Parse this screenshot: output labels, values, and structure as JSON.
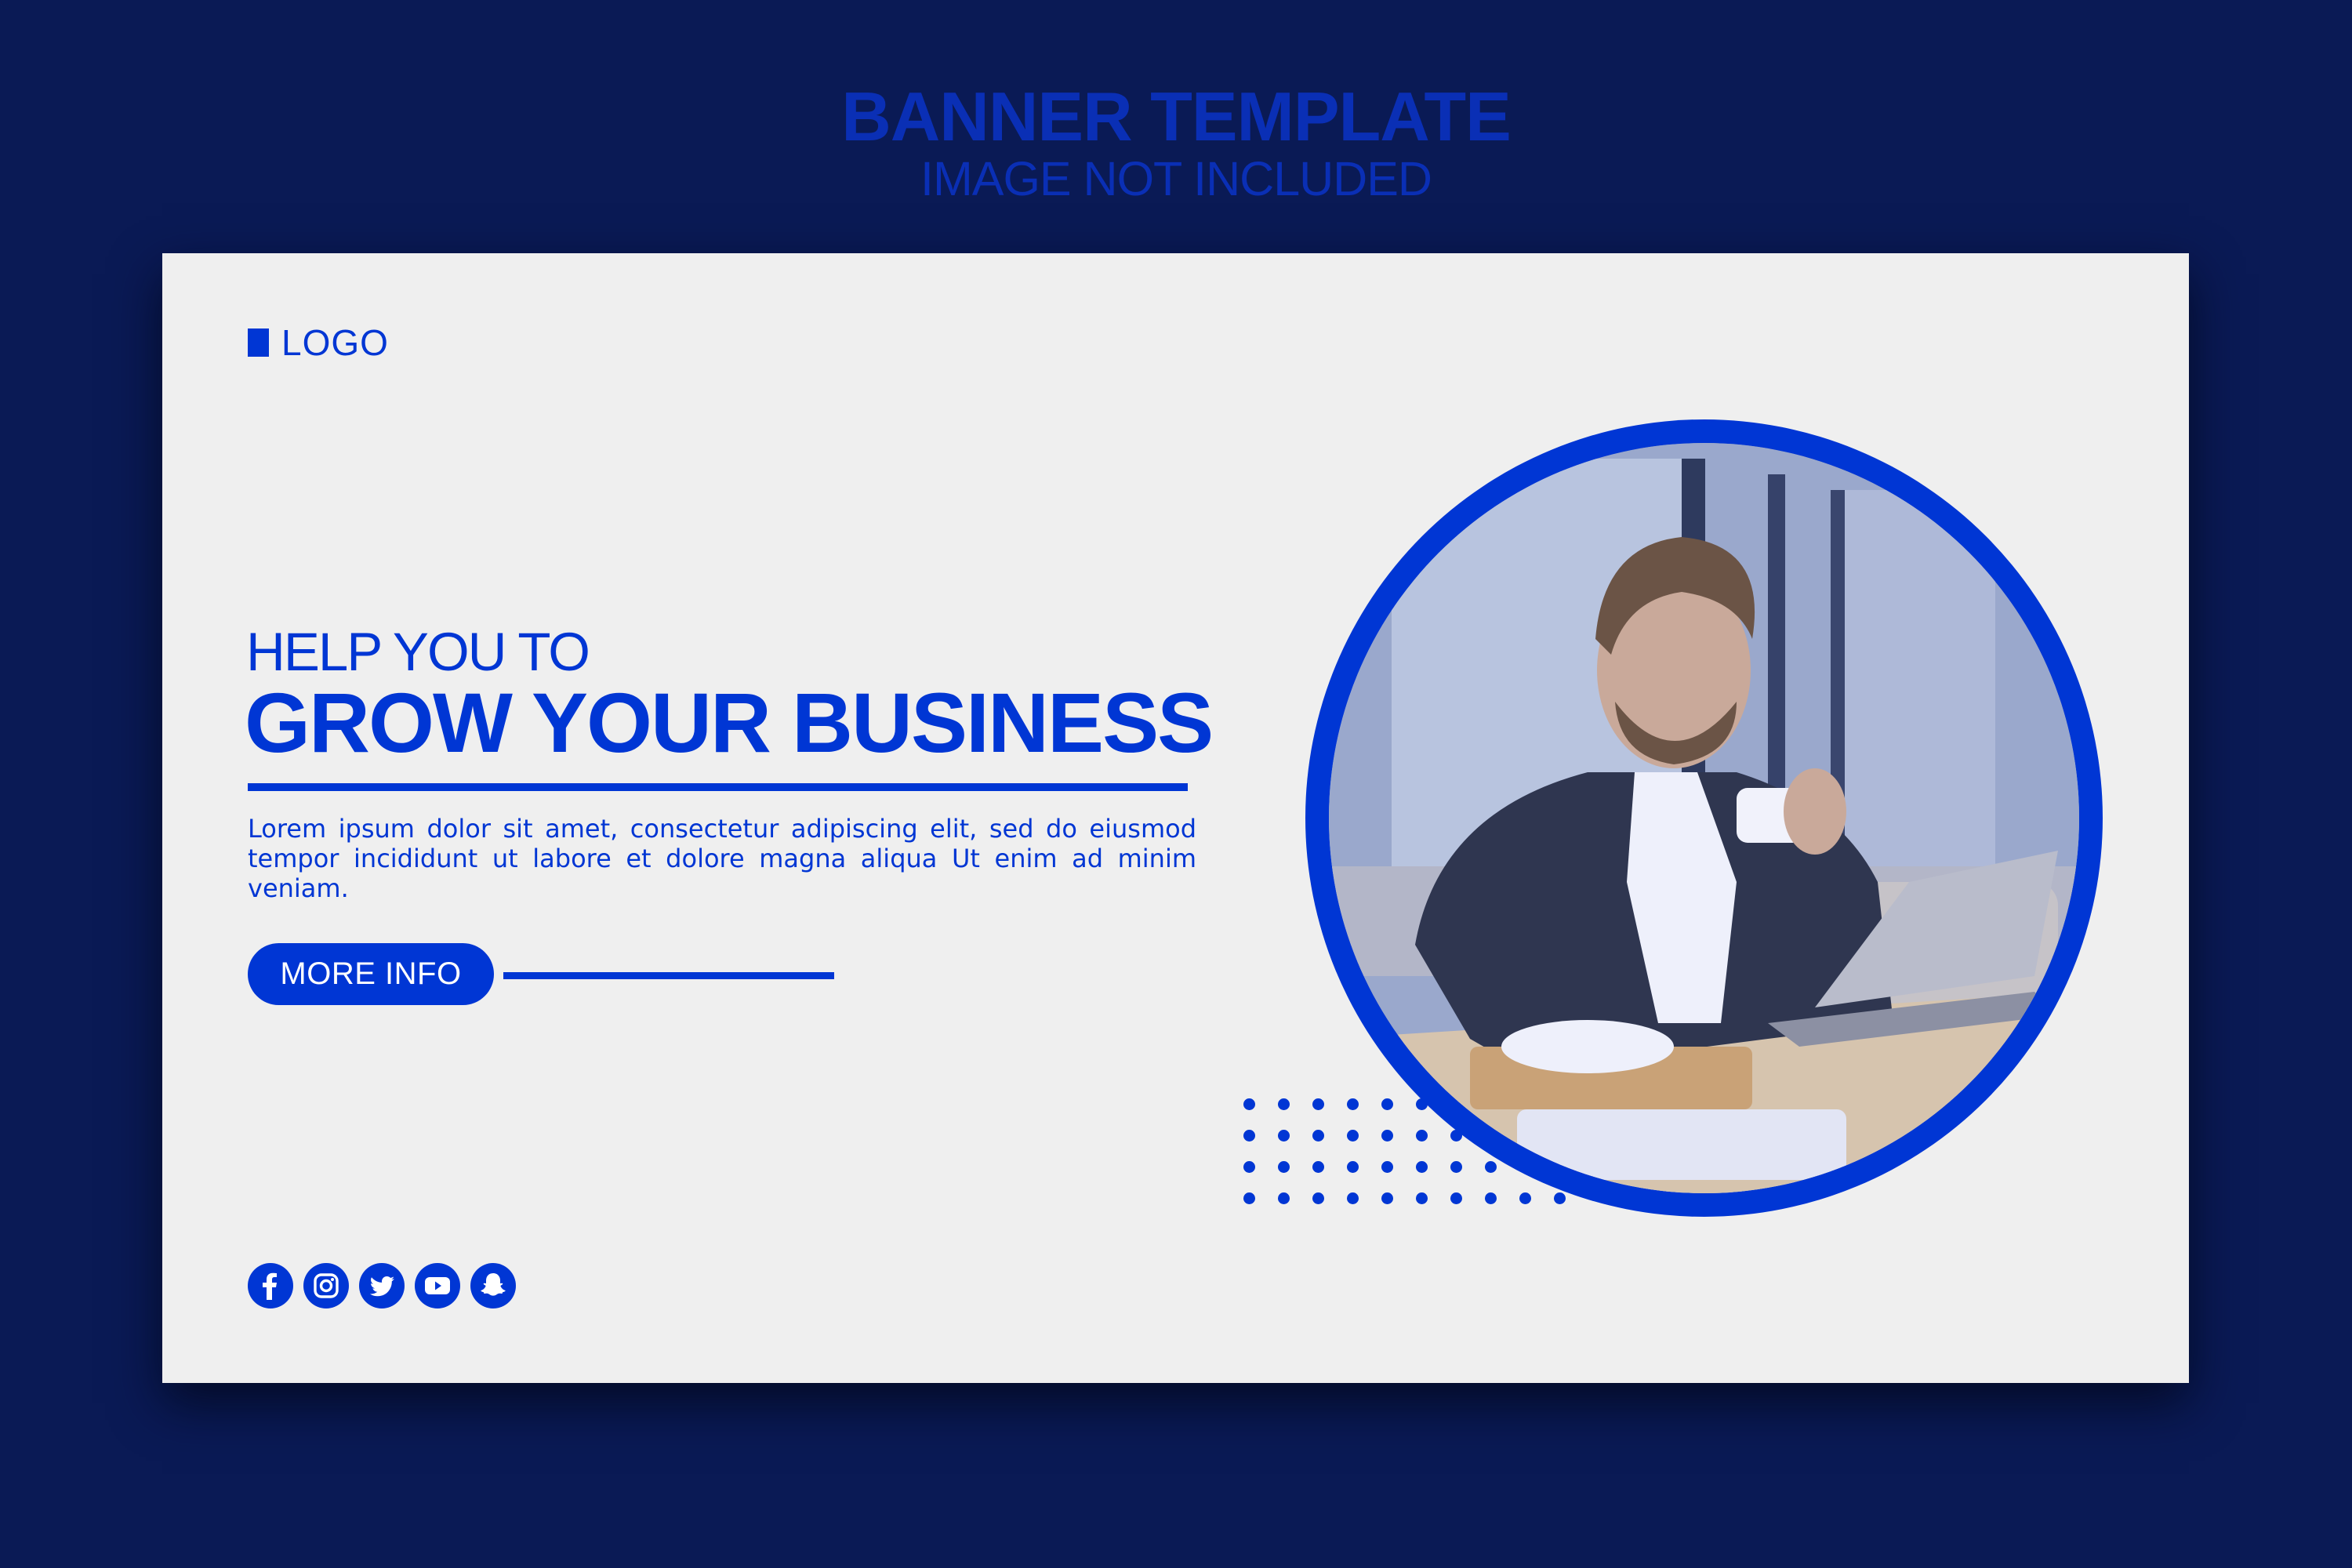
{
  "page_header": {
    "title": "BANNER TEMPLATE",
    "subtitle": "IMAGE NOT INCLUDED"
  },
  "banner": {
    "logo_text": "LOGO",
    "headline_small": "HELP YOU TO",
    "headline_big": "GROW YOUR BUSINESS",
    "body": "Lorem ipsum dolor sit amet, consectetur adipiscing elit, sed do eiusmod tempor incididunt ut labore et dolore magna aliqua Ut enim ad minim veniam.",
    "cta_label": "MORE INFO",
    "photo_description": "smiling businessman in suit holding coffee cup at laptop",
    "social_icons": [
      "facebook-icon",
      "instagram-icon",
      "twitter-icon",
      "youtube-icon",
      "snapchat-icon"
    ],
    "dot_rows": [
      6,
      7,
      8,
      10
    ]
  },
  "colors": {
    "background": "#0a1a55",
    "accent": "#0036d4",
    "card": "#efefef",
    "header_text": "#0a2fb5"
  }
}
